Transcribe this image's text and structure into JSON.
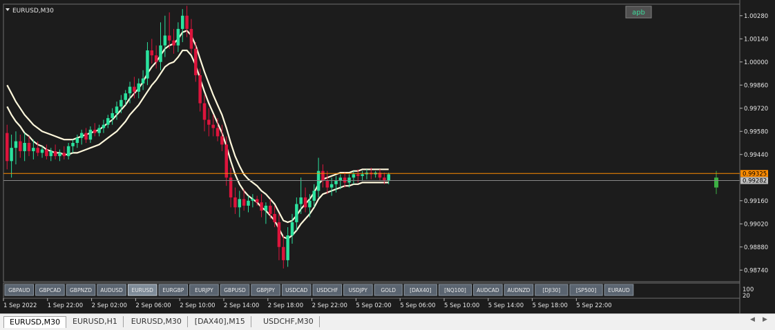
{
  "window": {
    "title": "EURUSD,M30",
    "menu_icon": "triangle-down-icon"
  },
  "indicator_button": "apb",
  "price_axis": {
    "ticks": [
      "1.00280",
      "1.00140",
      "1.00000",
      "0.99860",
      "0.99720",
      "0.99580",
      "0.99440",
      "0.99160",
      "0.99020",
      "0.98880",
      "0.98740"
    ]
  },
  "time_axis": {
    "labels": [
      "1 Sep 2022",
      "1 Sep 22:00",
      "2 Sep 02:00",
      "2 Sep 06:00",
      "2 Sep 10:00",
      "2 Sep 14:00",
      "2 Sep 18:00",
      "2 Sep 22:00",
      "5 Sep 02:00",
      "5 Sep 06:00",
      "5 Sep 10:00",
      "5 Sep 14:00",
      "5 Sep 18:00",
      "5 Sep 22:00"
    ]
  },
  "price_labels": {
    "ask": "0.99325",
    "bid": "0.99282",
    "ask_color": "#ff8c00",
    "bid_color": "#c0c0c0"
  },
  "subwindow_scale": {
    "top": "100",
    "bottom": "20"
  },
  "symbol_bar": [
    {
      "label": "GBPAUD"
    },
    {
      "label": "GBPCAD"
    },
    {
      "label": "GBPNZD"
    },
    {
      "label": "AUDUSD"
    },
    {
      "label": "EURUSD",
      "active": true
    },
    {
      "label": "EURGBP"
    },
    {
      "label": "EURJPY"
    },
    {
      "label": "GBPUSD"
    },
    {
      "label": "GBPJPY"
    },
    {
      "label": "USDCAD"
    },
    {
      "label": "USDCHF"
    },
    {
      "label": "USDJPY"
    },
    {
      "label": "GOLD"
    },
    {
      "label": "[DAX40]"
    },
    {
      "label": "[NQ100]"
    },
    {
      "label": "AUDCAD"
    },
    {
      "label": "AUDNZD"
    },
    {
      "label": "[DJI30]"
    },
    {
      "label": "[SP500]"
    },
    {
      "label": "EURAUD"
    }
  ],
  "tabs": [
    {
      "label": "EURUSD,M30",
      "active": true
    },
    {
      "label": "EURUSD,H1"
    },
    {
      "label": "EURUSD,M30"
    },
    {
      "label": "[DAX40],M15"
    },
    {
      "label": "USDCHF,M30"
    }
  ],
  "colors": {
    "bull": "#2be29e",
    "bear": "#dc143c",
    "band": "#fff8dc",
    "background": "#1c1c1c"
  },
  "chart_data": {
    "type": "candlestick",
    "symbol": "EURUSD",
    "timeframe": "M30",
    "ylim": [
      0.9867,
      1.0035
    ],
    "ask": 0.99325,
    "bid": 0.99282,
    "candles": [
      {
        "o": 0.9957,
        "h": 0.9962,
        "l": 0.9935,
        "c": 0.994
      },
      {
        "o": 0.994,
        "h": 0.9956,
        "l": 0.993,
        "c": 0.9948
      },
      {
        "o": 0.9948,
        "h": 0.9958,
        "l": 0.9938,
        "c": 0.9952
      },
      {
        "o": 0.9952,
        "h": 0.9956,
        "l": 0.9942,
        "c": 0.9946
      },
      {
        "o": 0.9946,
        "h": 0.9957,
        "l": 0.994,
        "c": 0.9951
      },
      {
        "o": 0.9951,
        "h": 0.9955,
        "l": 0.9943,
        "c": 0.9946
      },
      {
        "o": 0.9946,
        "h": 0.9953,
        "l": 0.9941,
        "c": 0.9948
      },
      {
        "o": 0.9948,
        "h": 0.9952,
        "l": 0.9943,
        "c": 0.9945
      },
      {
        "o": 0.9945,
        "h": 0.9949,
        "l": 0.9942,
        "c": 0.9947
      },
      {
        "o": 0.9947,
        "h": 0.995,
        "l": 0.9941,
        "c": 0.9943
      },
      {
        "o": 0.9943,
        "h": 0.9948,
        "l": 0.994,
        "c": 0.9946
      },
      {
        "o": 0.9946,
        "h": 0.995,
        "l": 0.9941,
        "c": 0.9943
      },
      {
        "o": 0.9943,
        "h": 0.9947,
        "l": 0.994,
        "c": 0.9945
      },
      {
        "o": 0.9945,
        "h": 0.9949,
        "l": 0.9941,
        "c": 0.9943
      },
      {
        "o": 0.9943,
        "h": 0.9951,
        "l": 0.9941,
        "c": 0.9949
      },
      {
        "o": 0.9949,
        "h": 0.9953,
        "l": 0.9945,
        "c": 0.9951
      },
      {
        "o": 0.9951,
        "h": 0.9956,
        "l": 0.9948,
        "c": 0.9954
      },
      {
        "o": 0.9954,
        "h": 0.9959,
        "l": 0.995,
        "c": 0.9957
      },
      {
        "o": 0.9957,
        "h": 0.996,
        "l": 0.9951,
        "c": 0.9953
      },
      {
        "o": 0.9953,
        "h": 0.9961,
        "l": 0.9951,
        "c": 0.9959
      },
      {
        "o": 0.9959,
        "h": 0.9963,
        "l": 0.9955,
        "c": 0.9957
      },
      {
        "o": 0.9957,
        "h": 0.9962,
        "l": 0.9955,
        "c": 0.996
      },
      {
        "o": 0.996,
        "h": 0.9965,
        "l": 0.9957,
        "c": 0.9962
      },
      {
        "o": 0.9962,
        "h": 0.9968,
        "l": 0.996,
        "c": 0.9966
      },
      {
        "o": 0.9966,
        "h": 0.9972,
        "l": 0.9962,
        "c": 0.9969
      },
      {
        "o": 0.9969,
        "h": 0.9976,
        "l": 0.9965,
        "c": 0.9973
      },
      {
        "o": 0.9973,
        "h": 0.998,
        "l": 0.9969,
        "c": 0.9977
      },
      {
        "o": 0.9977,
        "h": 0.9983,
        "l": 0.9974,
        "c": 0.9981
      },
      {
        "o": 0.9981,
        "h": 0.9988,
        "l": 0.9975,
        "c": 0.9985
      },
      {
        "o": 0.9985,
        "h": 0.9991,
        "l": 0.9978,
        "c": 0.9982
      },
      {
        "o": 0.9982,
        "h": 0.999,
        "l": 0.9978,
        "c": 0.9987
      },
      {
        "o": 0.9987,
        "h": 0.9995,
        "l": 0.9983,
        "c": 0.999
      },
      {
        "o": 0.999,
        "h": 1.0012,
        "l": 0.9986,
        "c": 1.0007
      },
      {
        "o": 1.0007,
        "h": 1.0014,
        "l": 0.9999,
        "c": 1.0004
      },
      {
        "o": 1.0004,
        "h": 1.001,
        "l": 0.9996,
        "c": 1.0
      },
      {
        "o": 1.0,
        "h": 1.0024,
        "l": 0.9995,
        "c": 1.001
      },
      {
        "o": 1.001,
        "h": 1.0028,
        "l": 1.0003,
        "c": 1.0016
      },
      {
        "o": 1.0016,
        "h": 1.003,
        "l": 1.0008,
        "c": 1.0013
      },
      {
        "o": 1.0013,
        "h": 1.002,
        "l": 1.0005,
        "c": 1.001
      },
      {
        "o": 1.001,
        "h": 1.0024,
        "l": 1.0006,
        "c": 1.002
      },
      {
        "o": 1.002,
        "h": 1.0032,
        "l": 1.0012,
        "c": 1.0028
      },
      {
        "o": 1.0028,
        "h": 1.0034,
        "l": 1.0015,
        "c": 1.002
      },
      {
        "o": 1.002,
        "h": 1.0026,
        "l": 1.0005,
        "c": 1.0008
      },
      {
        "o": 1.0008,
        "h": 1.0012,
        "l": 0.9988,
        "c": 0.9992
      },
      {
        "o": 0.9992,
        "h": 0.9996,
        "l": 0.997,
        "c": 0.9975
      },
      {
        "o": 0.9975,
        "h": 0.998,
        "l": 0.9958,
        "c": 0.9965
      },
      {
        "o": 0.9965,
        "h": 0.9972,
        "l": 0.9955,
        "c": 0.9962
      },
      {
        "o": 0.9962,
        "h": 0.9968,
        "l": 0.9955,
        "c": 0.996
      },
      {
        "o": 0.996,
        "h": 0.9966,
        "l": 0.9952,
        "c": 0.9955
      },
      {
        "o": 0.9955,
        "h": 0.9962,
        "l": 0.9946,
        "c": 0.995
      },
      {
        "o": 0.995,
        "h": 0.9955,
        "l": 0.9925,
        "c": 0.993
      },
      {
        "o": 0.993,
        "h": 0.9936,
        "l": 0.9912,
        "c": 0.9918
      },
      {
        "o": 0.9918,
        "h": 0.9924,
        "l": 0.9908,
        "c": 0.9912
      },
      {
        "o": 0.9912,
        "h": 0.9922,
        "l": 0.9906,
        "c": 0.9917
      },
      {
        "o": 0.9917,
        "h": 0.9923,
        "l": 0.991,
        "c": 0.9913
      },
      {
        "o": 0.9913,
        "h": 0.9919,
        "l": 0.9909,
        "c": 0.9916
      },
      {
        "o": 0.9916,
        "h": 0.992,
        "l": 0.9912,
        "c": 0.9917
      },
      {
        "o": 0.9917,
        "h": 0.9919,
        "l": 0.9913,
        "c": 0.9915
      },
      {
        "o": 0.9915,
        "h": 0.992,
        "l": 0.9906,
        "c": 0.991
      },
      {
        "o": 0.991,
        "h": 0.9915,
        "l": 0.9902,
        "c": 0.9913
      },
      {
        "o": 0.9913,
        "h": 0.9917,
        "l": 0.9905,
        "c": 0.9908
      },
      {
        "o": 0.9908,
        "h": 0.9913,
        "l": 0.99,
        "c": 0.9903
      },
      {
        "o": 0.9903,
        "h": 0.9908,
        "l": 0.988,
        "c": 0.9888
      },
      {
        "o": 0.9888,
        "h": 0.9895,
        "l": 0.9875,
        "c": 0.988
      },
      {
        "o": 0.988,
        "h": 0.99,
        "l": 0.9876,
        "c": 0.9895
      },
      {
        "o": 0.9895,
        "h": 0.9908,
        "l": 0.989,
        "c": 0.9903
      },
      {
        "o": 0.9903,
        "h": 0.9918,
        "l": 0.9898,
        "c": 0.9914
      },
      {
        "o": 0.9914,
        "h": 0.993,
        "l": 0.9908,
        "c": 0.9918
      },
      {
        "o": 0.9918,
        "h": 0.9924,
        "l": 0.9909,
        "c": 0.9912
      },
      {
        "o": 0.9912,
        "h": 0.992,
        "l": 0.9906,
        "c": 0.9916
      },
      {
        "o": 0.9916,
        "h": 0.9926,
        "l": 0.9912,
        "c": 0.9922
      },
      {
        "o": 0.9922,
        "h": 0.9942,
        "l": 0.9918,
        "c": 0.9934
      },
      {
        "o": 0.9934,
        "h": 0.9938,
        "l": 0.9924,
        "c": 0.9928
      },
      {
        "o": 0.9928,
        "h": 0.9934,
        "l": 0.992,
        "c": 0.9924
      },
      {
        "o": 0.9924,
        "h": 0.993,
        "l": 0.9919,
        "c": 0.9926
      },
      {
        "o": 0.9926,
        "h": 0.9931,
        "l": 0.9921,
        "c": 0.9928
      },
      {
        "o": 0.9928,
        "h": 0.9932,
        "l": 0.9923,
        "c": 0.993
      },
      {
        "o": 0.993,
        "h": 0.9933,
        "l": 0.9924,
        "c": 0.9927
      },
      {
        "o": 0.9927,
        "h": 0.9932,
        "l": 0.9924,
        "c": 0.993
      },
      {
        "o": 0.993,
        "h": 0.9934,
        "l": 0.9926,
        "c": 0.9932
      },
      {
        "o": 0.9932,
        "h": 0.9935,
        "l": 0.9927,
        "c": 0.9931
      },
      {
        "o": 0.9931,
        "h": 0.9934,
        "l": 0.9928,
        "c": 0.9932
      },
      {
        "o": 0.9932,
        "h": 0.9935,
        "l": 0.9929,
        "c": 0.9933
      },
      {
        "o": 0.9933,
        "h": 0.9936,
        "l": 0.9929,
        "c": 0.9932
      },
      {
        "o": 0.9932,
        "h": 0.9934,
        "l": 0.993,
        "c": 0.9933
      },
      {
        "o": 0.9933,
        "h": 0.9935,
        "l": 0.9928,
        "c": 0.993
      },
      {
        "o": 0.993,
        "h": 0.9933,
        "l": 0.9926,
        "c": 0.9928
      },
      {
        "o": 0.9928,
        "h": 0.9933,
        "l": 0.9926,
        "c": 0.9932
      }
    ],
    "upper_band": [
      0.9986,
      0.9981,
      0.9976,
      0.9972,
      0.9968,
      0.9965,
      0.9962,
      0.996,
      0.9958,
      0.9957,
      0.9956,
      0.9955,
      0.9954,
      0.9953,
      0.9953,
      0.9953,
      0.9954,
      0.9955,
      0.9956,
      0.9957,
      0.9958,
      0.9959,
      0.9961,
      0.9963,
      0.9965,
      0.9968,
      0.9971,
      0.9974,
      0.9978,
      0.9981,
      0.9984,
      0.9988,
      0.9993,
      0.9997,
      1.0,
      1.0004,
      1.0008,
      1.001,
      1.0011,
      1.0014,
      1.0018,
      1.0019,
      1.0016,
      1.001,
      1.0002,
      0.9994,
      0.9987,
      0.998,
      0.9974,
      0.9968,
      0.996,
      0.9951,
      0.9943,
      0.9937,
      0.9932,
      0.9929,
      0.9927,
      0.9925,
      0.9922,
      0.992,
      0.9917,
      0.9914,
      0.9909,
      0.9904,
      0.9903,
      0.9904,
      0.9907,
      0.9911,
      0.9914,
      0.9917,
      0.9921,
      0.9926,
      0.9929,
      0.993,
      0.9931,
      0.9932,
      0.9933,
      0.9933,
      0.9933,
      0.9934,
      0.9934,
      0.9935,
      0.9935,
      0.9935,
      0.9935,
      0.9935,
      0.9935,
      0.9935
    ],
    "lower_band": [
      0.9973,
      0.9968,
      0.9964,
      0.9961,
      0.9957,
      0.9955,
      0.9952,
      0.995,
      0.9949,
      0.9947,
      0.9946,
      0.9945,
      0.9945,
      0.9944,
      0.9944,
      0.9945,
      0.9945,
      0.9946,
      0.9947,
      0.9948,
      0.9949,
      0.995,
      0.9952,
      0.9954,
      0.9956,
      0.9958,
      0.9961,
      0.9964,
      0.9968,
      0.9971,
      0.9974,
      0.9978,
      0.9982,
      0.9986,
      0.9989,
      0.9993,
      0.9997,
      0.9999,
      1.0,
      1.0003,
      1.0007,
      1.0007,
      1.0004,
      0.9998,
      0.999,
      0.9982,
      0.9975,
      0.9969,
      0.9963,
      0.9957,
      0.9949,
      0.994,
      0.9932,
      0.9926,
      0.9922,
      0.9919,
      0.9917,
      0.9915,
      0.9912,
      0.991,
      0.9907,
      0.9904,
      0.9899,
      0.9894,
      0.9893,
      0.9895,
      0.9898,
      0.9902,
      0.9905,
      0.9908,
      0.9912,
      0.9917,
      0.992,
      0.9921,
      0.9922,
      0.9923,
      0.9924,
      0.9925,
      0.9925,
      0.9926,
      0.9926,
      0.9927,
      0.9927,
      0.9927,
      0.9927,
      0.9927,
      0.9927,
      0.9927
    ],
    "subwindow_bar": {
      "o": 0.993,
      "h": 0.9934,
      "l": 0.992,
      "c": 0.9924
    }
  }
}
